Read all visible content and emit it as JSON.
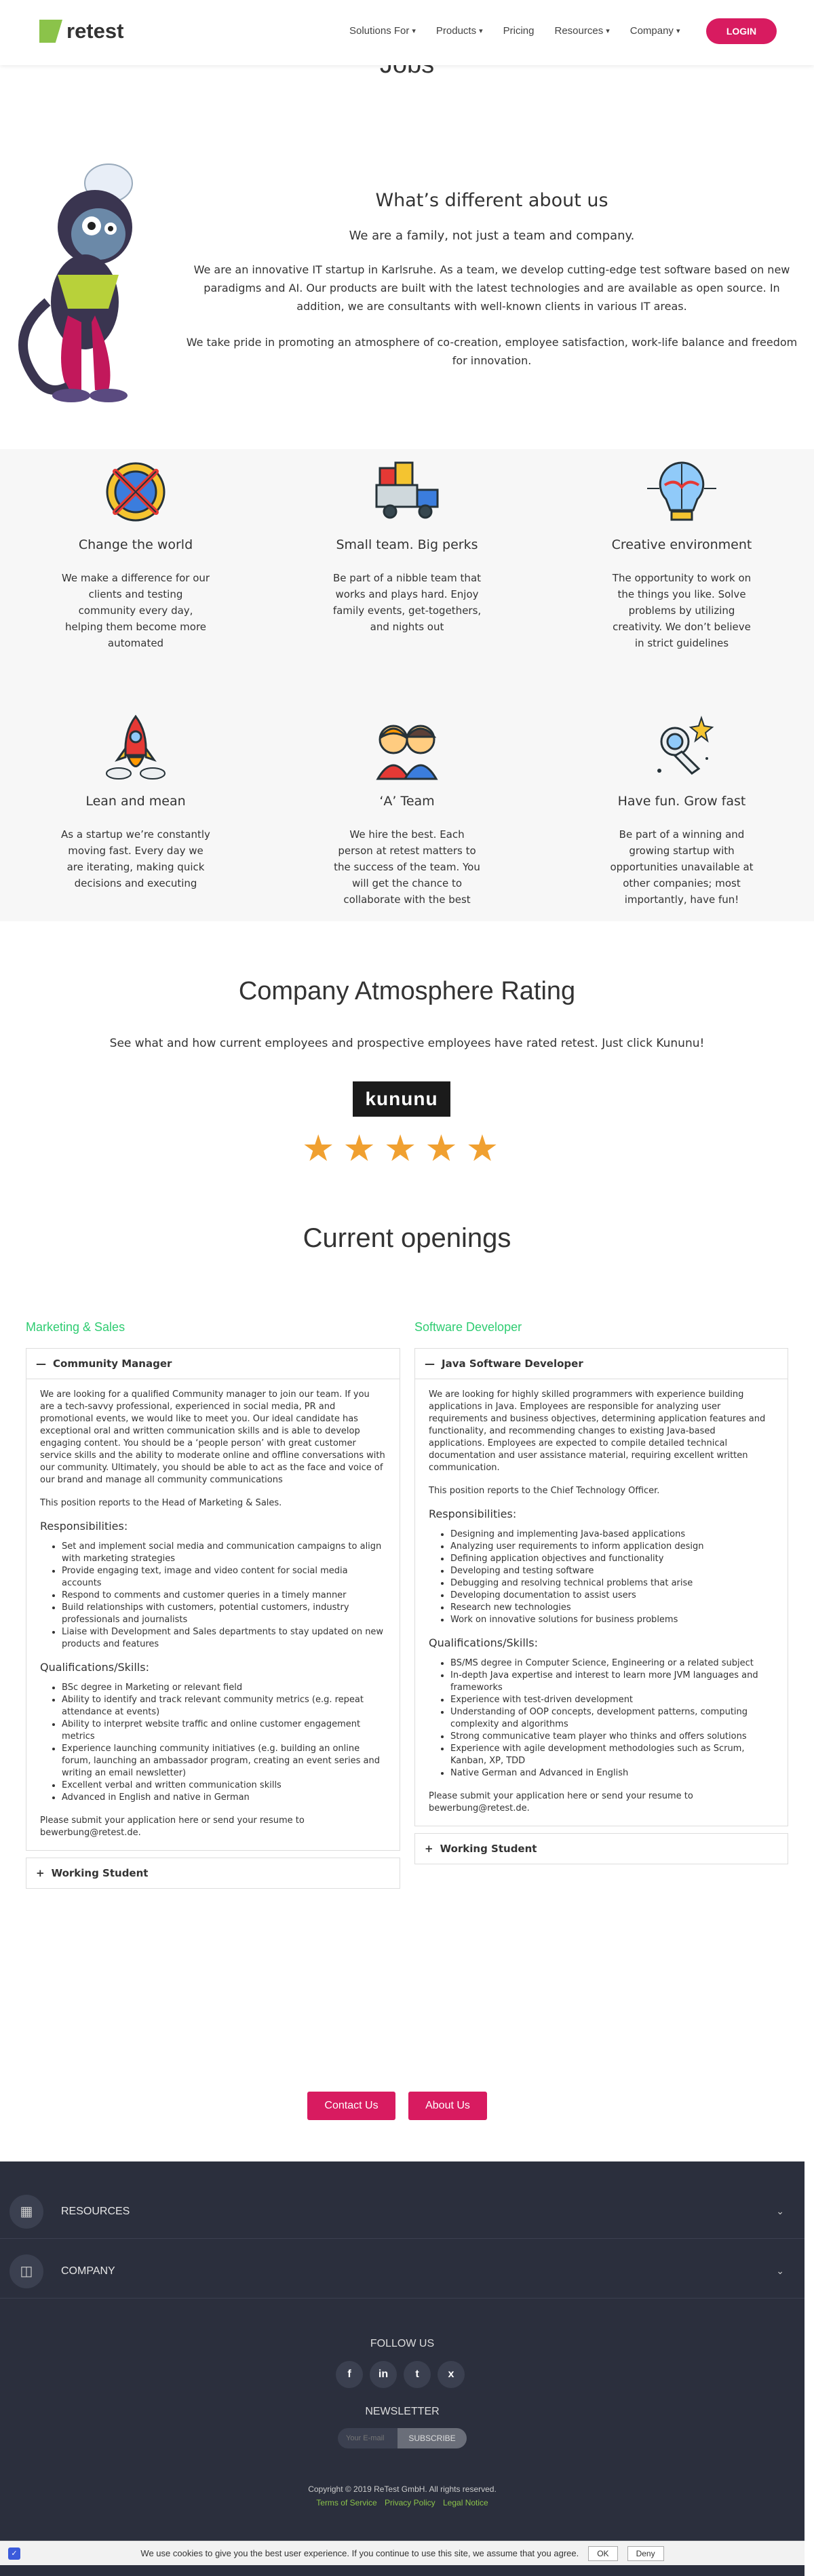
{
  "header": {
    "logo": "retest",
    "nav": [
      "Solutions For",
      "Products",
      "Pricing",
      "Resources",
      "Company"
    ],
    "nav_dropdown": [
      true,
      true,
      false,
      true,
      true
    ],
    "login": "LOGIN"
  },
  "page_title": "Jobs",
  "about": {
    "title": "What’s different about us",
    "subtitle": "We are a family, not just a team and company.",
    "p1": "We are an innovative IT startup in Karlsruhe. As a team, we develop cutting-edge test software based on new paradigms and AI. Our products are built with the latest technologies and are available as open source. In addition, we are consultants with well-known clients in various IT areas.",
    "p2": "We take pride in promoting an atmosphere of co-creation, employee satisfaction, work-life balance and freedom for innovation."
  },
  "features": [
    {
      "title": "Change the world",
      "text": "We make a difference for our clients and testing community every day, helping them become more automated",
      "icon": "tools-icon"
    },
    {
      "title": "Small team. Big perks",
      "text": "Be part of a nibble team that works and plays hard. Enjoy family events, get-togethers, and nights out",
      "icon": "truck-icon"
    },
    {
      "title": "Creative environment",
      "text": "The opportunity to work on the things you like. Solve problems by utilizing creativity. We don’t believe in strict guidelines",
      "icon": "lightbulb-icon"
    },
    {
      "title": "Lean and mean",
      "text": "As a startup we’re constantly moving fast. Every day we are iterating, making quick decisions and executing",
      "icon": "rocket-icon"
    },
    {
      "title": "‘A’ Team",
      "text": "We hire the best. Each person at retest matters to the success of the team. You will get the chance to collaborate with the best",
      "icon": "team-icon"
    },
    {
      "title": "Have fun. Grow fast",
      "text": "Be part of a winning and growing startup with opportunities unavailable at other companies; most importantly, have fun!",
      "icon": "astronaut-icon"
    }
  ],
  "rating": {
    "title": "Company Atmosphere Rating",
    "text": "See what and how current employees and prospective employees have rated retest. Just click Kununu!",
    "kununu": "kununu",
    "stars": 5
  },
  "openings": {
    "title": "Current openings",
    "marketing": {
      "category": "Marketing & Sales",
      "job1": {
        "title": "Community Manager",
        "intro": "We are looking for a qualified Community manager to join our team. If you are a tech-savvy professional, experienced in social media, PR and promotional events, we would like to meet you. Our ideal candidate has exceptional oral and written communication skills and is able to develop engaging content. You should be a ‘people person’ with great customer service skills and the ability to moderate online and offline conversations with our community. Ultimately, you should be able to act as the face and voice of our brand and manage all community communications",
        "reports": "This position reports to the Head of Marketing & Sales.",
        "resp_label": "Responsibilities:",
        "resp": [
          "Set and implement social media and communication campaigns to align with marketing strategies",
          "Provide engaging text, image and video content for social media accounts",
          "Respond to comments and customer queries in a timely manner",
          "Build relationships with customers, potential customers, industry professionals and journalists",
          "Liaise with Development and Sales departments to stay updated on new products and features"
        ],
        "qual_label": "Qualifications/Skills:",
        "qual": [
          "BSc degree in Marketing or relevant field",
          "Ability to identify and track relevant community metrics (e.g. repeat attendance at events)",
          "Ability to interpret website traffic and online customer engagement metrics",
          "Experience launching community initiatives (e.g. building an online forum, launching an ambassador program, creating an event series and writing an email newsletter)",
          "Excellent verbal and written communication skills",
          "Advanced in English and native in German"
        ],
        "apply": "Please submit your application here or send your resume to bewerbung@retest.de."
      },
      "job2": {
        "title": "Working Student"
      }
    },
    "developer": {
      "category": "Software Developer",
      "job1": {
        "title": "Java Software Developer",
        "intro": "We are looking for highly skilled programmers with experience building applications in Java. Employees are responsible for analyzing user requirements and business objectives, determining application features and functionality, and recommending changes to existing Java-based applications. Employees are expected to compile detailed technical documentation and user assistance material, requiring excellent written communication.",
        "reports": "This position reports to the Chief Technology Officer.",
        "resp_label": "Responsibilities:",
        "resp": [
          "Designing and implementing Java-based applications",
          "Analyzing user requirements to inform application design",
          "Defining application objectives and functionality",
          "Developing and testing software",
          "Debugging and resolving technical problems that arise",
          "Developing documentation to assist users",
          "Research new technologies",
          "Work on innovative solutions for business problems"
        ],
        "qual_label": "Qualifications/Skills:",
        "qual": [
          "BS/MS degree in Computer Science, Engineering or a related subject",
          "In-depth Java expertise and interest to learn more JVM languages and frameworks",
          "Experience with test-driven development",
          "Understanding of OOP concepts, development patterns, computing complexity and algorithms",
          "Strong communicative team player who thinks and offers solutions",
          "Experience with agile development methodologies such as Scrum, Kanban, XP, TDD",
          "Native German and Advanced in English"
        ],
        "apply": "Please submit your application here or send your resume to bewerbung@retest.de."
      },
      "job2": {
        "title": "Working Student"
      }
    }
  },
  "cta": {
    "contact": "Contact Us",
    "about": "About Us"
  },
  "footer": {
    "resources": "RESOURCES",
    "company": "COMPANY",
    "follow": "FOLLOW US",
    "socials": [
      "f",
      "in",
      "t",
      "x"
    ],
    "newsletter": "NEWSLETTER",
    "email_placeholder": "Your E-mail",
    "subscribe": "SUBSCRIBE",
    "copyright": "Copyright © 2019 ReTest GmbH. All rights reserved.",
    "links": [
      "Terms of Service",
      "Privacy Policy",
      "Legal Notice"
    ]
  },
  "cookie": {
    "text": "We use cookies to give you the best user experience. If you continue to use this site, we assume that you agree.",
    "ok": "OK",
    "deny": "Deny"
  },
  "colors": {
    "accent": "#d81b60",
    "green": "#2ecc71",
    "brand": "#8bc34a",
    "footer": "#2b2f3d",
    "star": "#f0a030"
  }
}
